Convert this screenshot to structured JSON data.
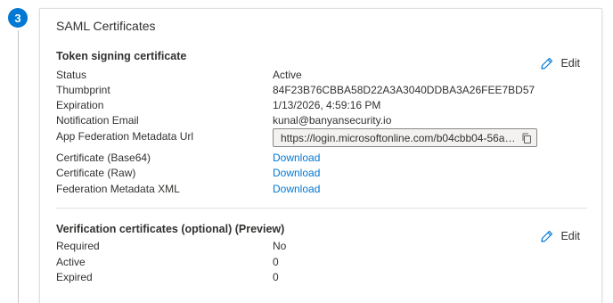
{
  "step": {
    "number": "3"
  },
  "card": {
    "title": "SAML Certificates"
  },
  "token_section": {
    "title": "Token signing certificate",
    "edit_label": "Edit",
    "status_label": "Status",
    "status_value": "Active",
    "thumbprint_label": "Thumbprint",
    "thumbprint_value": "84F23B76CBBA58D22A3A3040DDBA3A26FEE7BD57",
    "expiration_label": "Expiration",
    "expiration_value": "1/13/2026, 4:59:16 PM",
    "notification_label": "Notification Email",
    "notification_value": "kunal@banyansecurity.io",
    "metadata_url_label": "App Federation Metadata Url",
    "metadata_url_value": "https://login.microsoftonline.com/b04cbb04-56a5...",
    "cert_base64_label": "Certificate (Base64)",
    "cert_base64_link": "Download",
    "cert_raw_label": "Certificate (Raw)",
    "cert_raw_link": "Download",
    "fed_xml_label": "Federation Metadata XML",
    "fed_xml_link": "Download"
  },
  "verification_section": {
    "title": "Verification certificates (optional) (Preview)",
    "edit_label": "Edit",
    "required_label": "Required",
    "required_value": "No",
    "active_label": "Active",
    "active_value": "0",
    "expired_label": "Expired",
    "expired_value": "0"
  },
  "colors": {
    "accent": "#0078d4",
    "text": "#323130",
    "border": "#e1dfdd"
  },
  "icons": {
    "edit": "pencil-icon",
    "copy": "copy-icon"
  }
}
